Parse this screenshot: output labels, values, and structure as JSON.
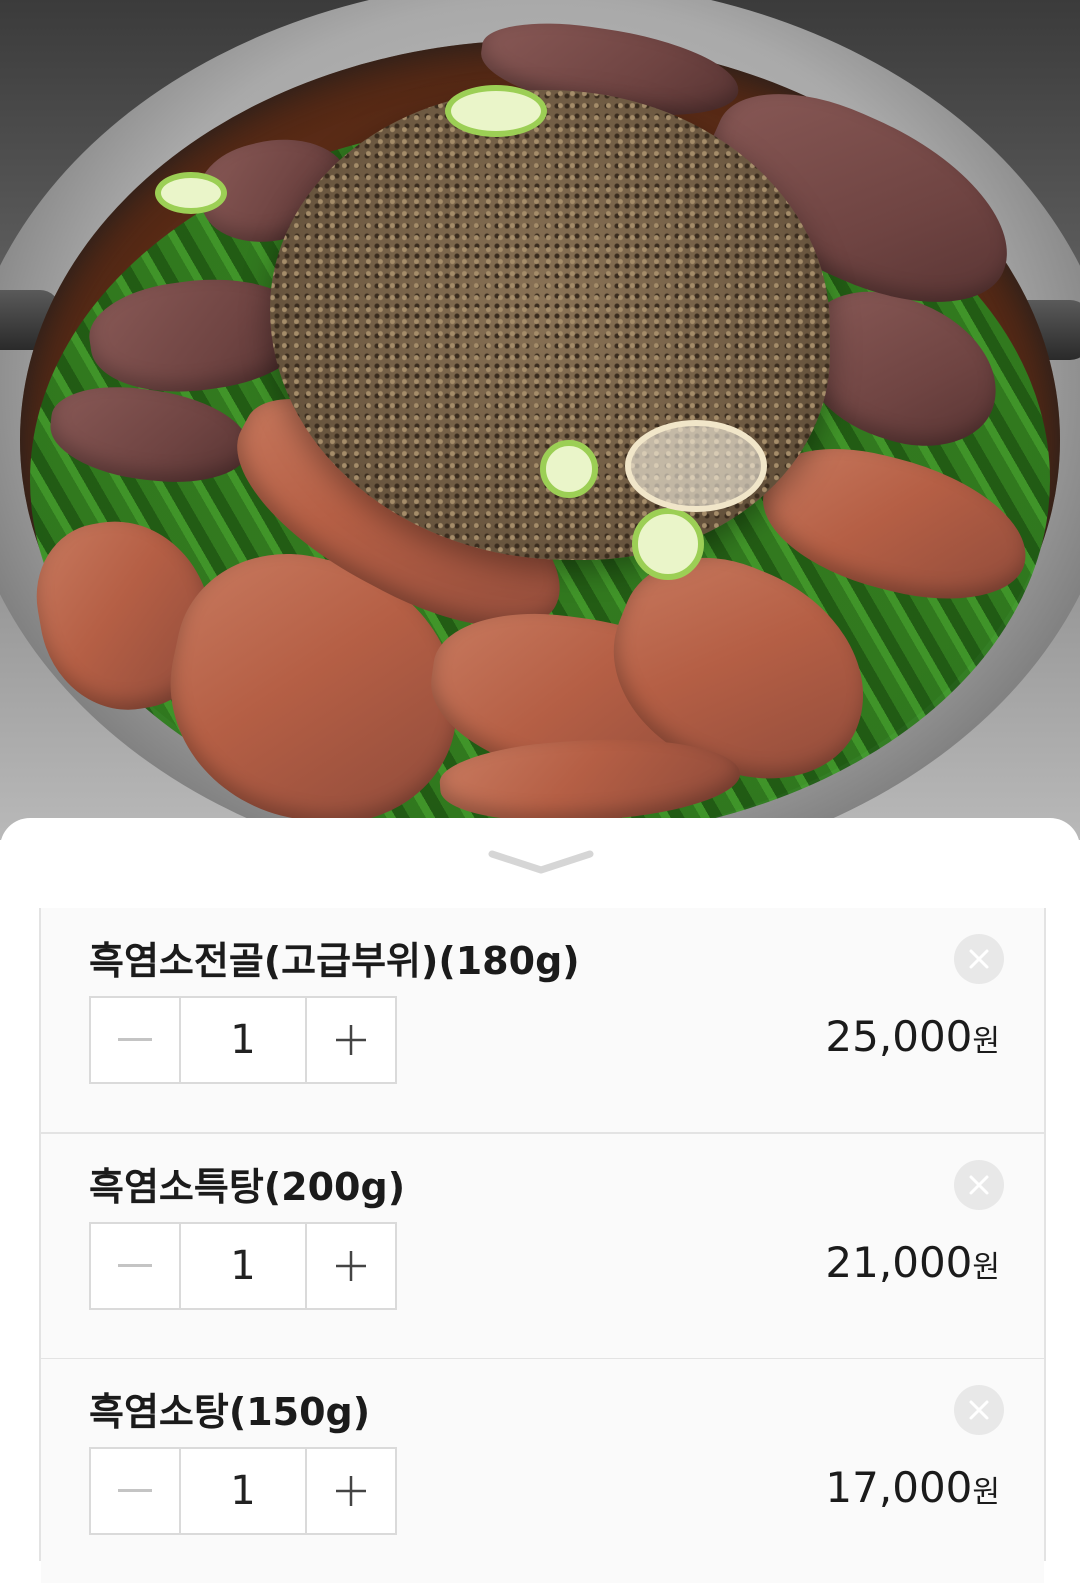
{
  "photo": {
    "description_icon": "food-photo"
  },
  "sheet": {
    "handle_icon": "chevron-down-icon"
  },
  "cart_items": [
    {
      "name": "흑염소전골(고급부위)(180g)",
      "quantity": "1",
      "price": "25,000",
      "currency": "원"
    },
    {
      "name": "흑염소특탕(200g)",
      "quantity": "1",
      "price": "21,000",
      "currency": "원"
    },
    {
      "name": "흑염소탕(150g)",
      "quantity": "1",
      "price": "17,000",
      "currency": "원"
    }
  ],
  "icons": {
    "remove": "close-icon",
    "decrease": "minus-icon",
    "increase": "plus-icon"
  }
}
